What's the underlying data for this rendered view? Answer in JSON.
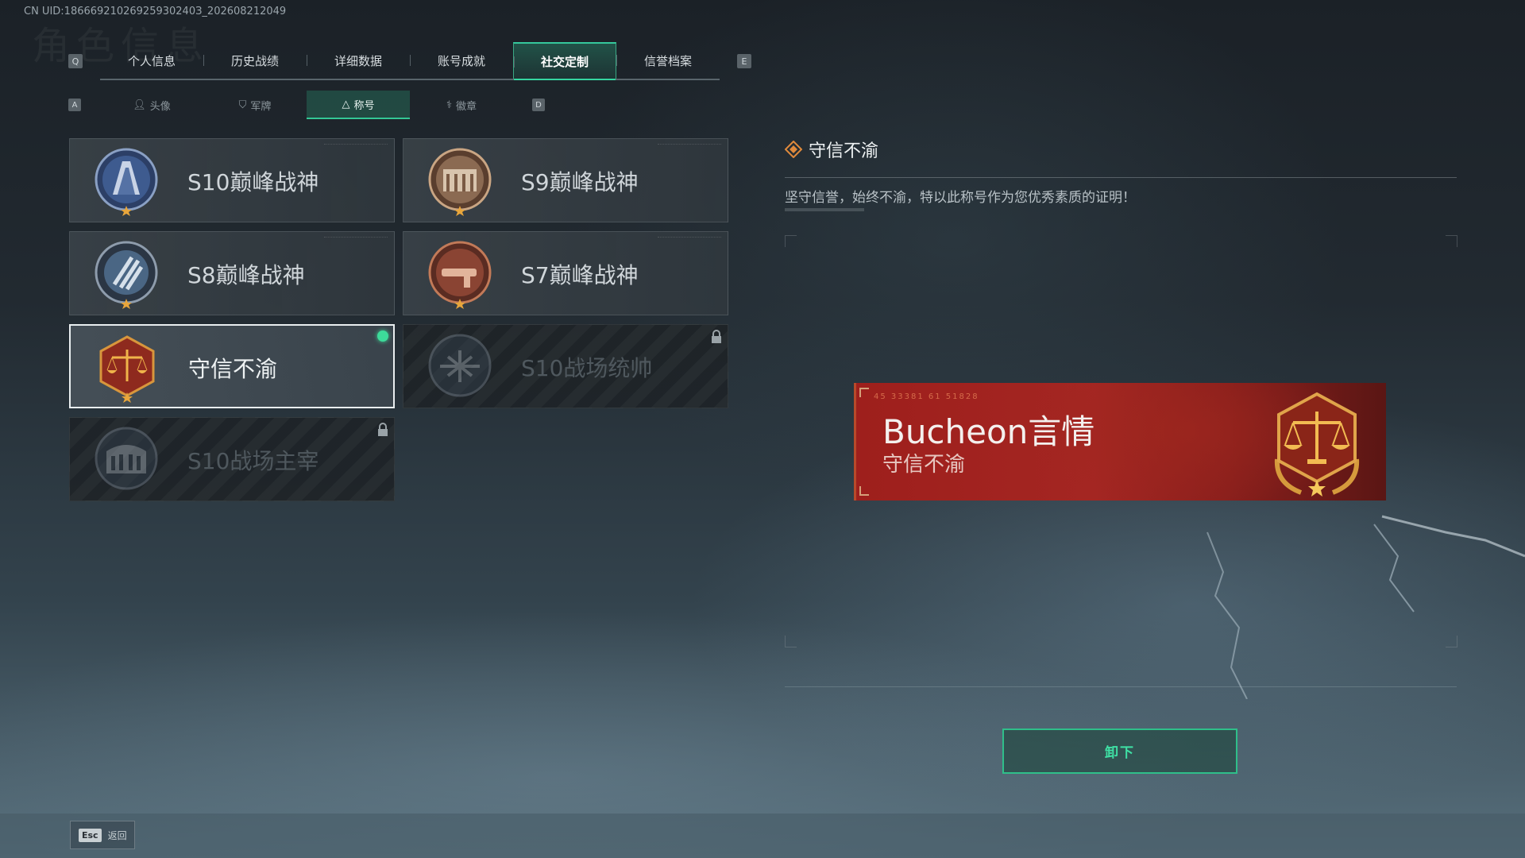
{
  "uid_text": "CN UID:18666921026925930240З_202608212049",
  "bg_title": "角色信息",
  "main_tabs": {
    "left_key": "Q",
    "right_key": "E",
    "items": [
      "个人信息",
      "历史战绩",
      "详细数据",
      "账号成就",
      "社交定制",
      "信誉档案"
    ],
    "active_index": 4
  },
  "sub_tabs": {
    "left_key": "A",
    "right_key": "D",
    "items": [
      "头像",
      "军牌",
      "称号",
      "徽章"
    ],
    "active_index": 2
  },
  "titles": [
    {
      "name": "S10巅峰战神",
      "state": "normal",
      "emblem": "s10-peak-emblem"
    },
    {
      "name": "S9巅峰战神",
      "state": "normal",
      "emblem": "s9-peak-emblem"
    },
    {
      "name": "S8巅峰战神",
      "state": "normal",
      "emblem": "s8-peak-emblem"
    },
    {
      "name": "S7巅峰战神",
      "state": "normal",
      "emblem": "s7-peak-emblem"
    },
    {
      "name": "守信不渝",
      "state": "equipped",
      "emblem": "scales-emblem"
    },
    {
      "name": "S10战场统帅",
      "state": "locked",
      "emblem": "aircraft-emblem"
    },
    {
      "name": "S10战场主宰",
      "state": "locked",
      "emblem": "colosseum-emblem"
    }
  ],
  "detail": {
    "title": "守信不渝",
    "description": "坚守信誉，始终不渝，特以此称号作为您优秀素质的证明！"
  },
  "banner": {
    "code": "45 33381  61 51828",
    "player_name": "Bucheon言情",
    "title": "守信不渝"
  },
  "unequip_label": "卸下",
  "footer": {
    "esc_key": "Esc",
    "back_label": "返回"
  },
  "colors": {
    "accent": "#33c795",
    "banner_red": "#9e1f1c",
    "equipped_dot": "#3ddb9a"
  }
}
